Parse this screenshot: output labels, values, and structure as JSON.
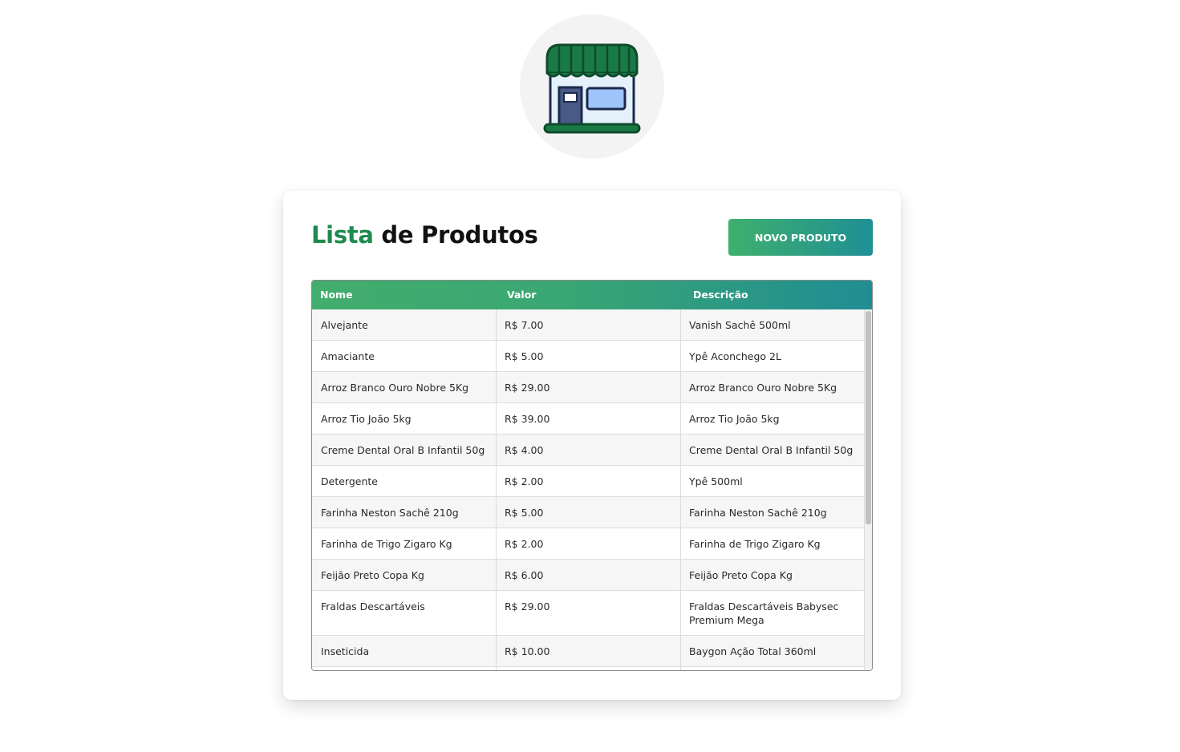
{
  "header": {
    "logo_icon": "storefront-icon"
  },
  "page": {
    "title_accent": "Lista",
    "title_rest": "de Produtos",
    "new_button_label": "NOVO PRODUTO"
  },
  "table": {
    "columns": [
      "Nome",
      "Valor",
      "Descrição"
    ],
    "rows": [
      [
        "Alvejante",
        "R$ 7.00",
        "Vanish Sachê 500ml"
      ],
      [
        "Amaciante",
        "R$ 5.00",
        "Ypê Aconchego 2L"
      ],
      [
        "Arroz Branco Ouro Nobre 5Kg",
        "R$ 29.00",
        "Arroz Branco Ouro Nobre 5Kg"
      ],
      [
        "Arroz Tio João 5kg",
        "R$ 39.00",
        "Arroz Tio João 5kg"
      ],
      [
        "Creme Dental Oral B Infantil 50g",
        "R$ 4.00",
        "Creme Dental Oral B Infantil 50g"
      ],
      [
        "Detergente",
        "R$ 2.00",
        "Ypê 500ml"
      ],
      [
        "Farinha Neston Sachê 210g",
        "R$ 5.00",
        "Farinha Neston Sachê 210g"
      ],
      [
        "Farinha de Trigo Zigaro Kg",
        "R$ 2.00",
        "Farinha de Trigo Zigaro Kg"
      ],
      [
        "Feijão Preto Copa Kg",
        "R$ 6.00",
        "Feijão Preto Copa Kg"
      ],
      [
        "Fraldas Descartáveis",
        "R$ 29.00",
        "Fraldas Descartáveis Babysec Premium Mega"
      ],
      [
        "Inseticida",
        "R$ 10.00",
        "Baygon Ação Total 360ml"
      ],
      [
        "",
        "",
        ""
      ]
    ]
  },
  "colors": {
    "accent_green": "#1e8a4f",
    "gradient_start": "#43ad6d",
    "gradient_end": "#208d93"
  }
}
